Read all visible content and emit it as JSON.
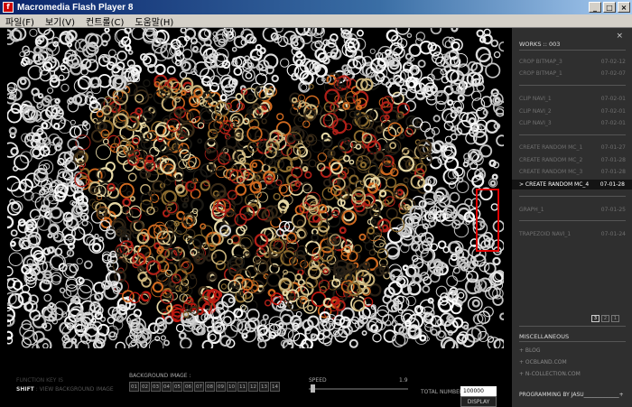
{
  "window": {
    "title": "Macromedia Flash Player 8",
    "minimize": "_",
    "maximize": "□",
    "close": "×"
  },
  "menu": [
    "파일(F)",
    "보기(V)",
    "컨트롤(C)",
    "도움말(H)"
  ],
  "controls": {
    "function_key": "FUNCTION KEY IS",
    "shift_key": "SHIFT",
    "shift_desc": " : VIEW BACKGROUND IMAGE",
    "background_label": "BACKGROUND IMAGE :",
    "background_buttons": [
      "01",
      "02",
      "03",
      "04",
      "05",
      "06",
      "07",
      "08",
      "09",
      "10",
      "11",
      "12",
      "13",
      "14"
    ],
    "speed_label": "SPEED",
    "speed_value": "1.9",
    "speed_level": 0.02,
    "display_label": "DISPLAY",
    "total_label": "TOTAL NUMBER :",
    "total_value": "100000"
  },
  "sidebar": {
    "close": "×",
    "works_title": "WORKS :: 003",
    "items": [
      {
        "name": "CROP BITMAP_3",
        "date": "07-02-12"
      },
      {
        "name": "CROP BITMAP_1",
        "date": "07-02-07"
      },
      {
        "name": "CLIP NAVI_1",
        "date": "07-02-01"
      },
      {
        "name": "CLIP NAVI_2",
        "date": "07-02-01"
      },
      {
        "name": "CLIP NAVI_3",
        "date": "07-02-01"
      },
      {
        "name": "CREATE RANDOM MC_1",
        "date": "07-01-27"
      },
      {
        "name": "CREATE RANDOM MC_2",
        "date": "07-01-28"
      },
      {
        "name": "CREATE RANDOM MC_3",
        "date": "07-01-28"
      },
      {
        "name": "> CREATE RANDOM MC_4",
        "date": "07-01-28"
      },
      {
        "name": "GRAPH_1",
        "date": "07-01-25"
      },
      {
        "name": "TRAPEZOID NAVI_1",
        "date": "07-01-24"
      }
    ],
    "pages": [
      "3",
      "2",
      "1"
    ],
    "misc_title": "MISCELLANEOUS",
    "misc_links": [
      "+ BLOG",
      "+ OCBLAND.COM",
      "+ N-COLLECTION.COM"
    ],
    "credit": "PROGRAMMING BY JASU_____________+"
  }
}
